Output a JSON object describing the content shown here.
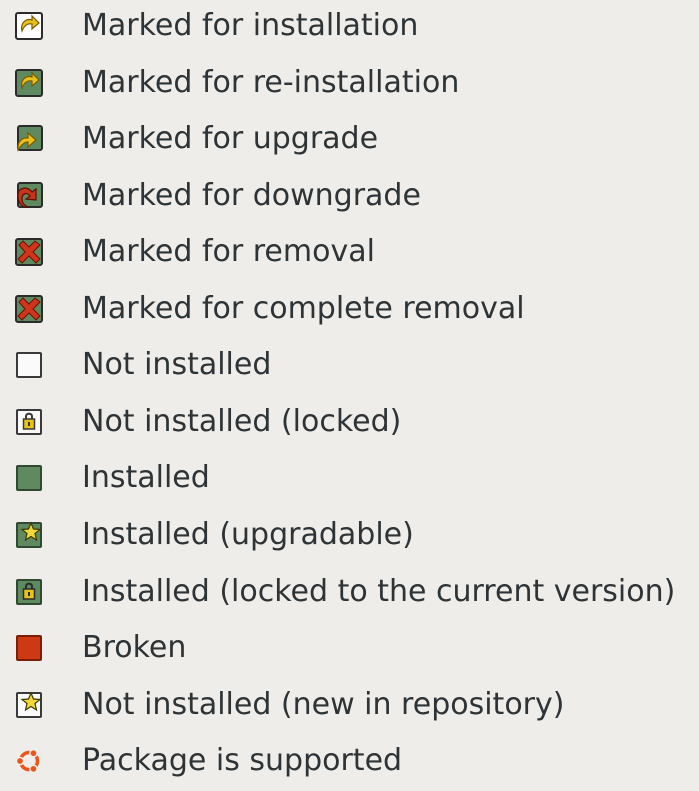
{
  "legend": {
    "items": [
      {
        "icon": "install-icon",
        "label": "Marked for installation"
      },
      {
        "icon": "reinstall-icon",
        "label": "Marked for re-installation"
      },
      {
        "icon": "upgrade-icon",
        "label": "Marked for upgrade"
      },
      {
        "icon": "downgrade-icon",
        "label": "Marked for downgrade"
      },
      {
        "icon": "removal-icon",
        "label": "Marked for removal"
      },
      {
        "icon": "complete-removal-icon",
        "label": "Marked for complete removal"
      },
      {
        "icon": "not-installed-icon",
        "label": "Not installed"
      },
      {
        "icon": "not-installed-locked-icon",
        "label": "Not installed (locked)"
      },
      {
        "icon": "installed-icon",
        "label": "Installed"
      },
      {
        "icon": "installed-upgradable-icon",
        "label": "Installed (upgradable)"
      },
      {
        "icon": "installed-locked-icon",
        "label": "Installed (locked to the current version)"
      },
      {
        "icon": "broken-icon",
        "label": "Broken"
      },
      {
        "icon": "new-in-repository-icon",
        "label": "Not installed (new in repository)"
      },
      {
        "icon": "supported-icon",
        "label": "Package is supported"
      }
    ]
  },
  "colors": {
    "background": "#efedea",
    "text": "#2e3436",
    "installed_green": "#5f8a60",
    "broken_red": "#cc3a14",
    "arrow_yellow": "#e8c21c",
    "remove_red": "#d0341a",
    "ubuntu_orange": "#e8561c"
  }
}
